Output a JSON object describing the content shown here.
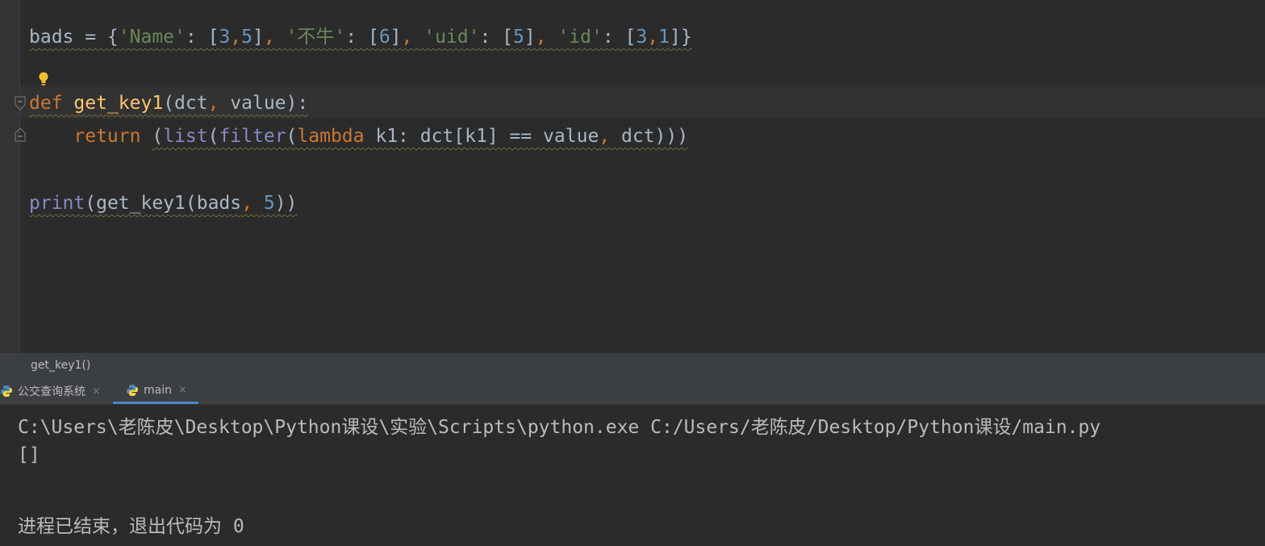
{
  "editor": {
    "line1": {
      "t1": "bads = {",
      "t2": "'Name'",
      "t3": ": [",
      "t4": "3",
      "t5": ",",
      "t6": "5",
      "t7": "]",
      "t8": ", ",
      "t9": "'不牛'",
      "t10": ": [",
      "t11": "6",
      "t12": "]",
      "t13": ", ",
      "t14": "'uid'",
      "t15": ": [",
      "t16": "5",
      "t17": "]",
      "t18": ", ",
      "t19": "'id'",
      "t20": ": [",
      "t21": "3",
      "t22": ",",
      "t23": "1",
      "t24": "]}"
    },
    "line3": {
      "kw": "def",
      "sp": " ",
      "fn": "get_key1",
      "p1": "(dct",
      "c": ", ",
      "p2": "value):"
    },
    "line4": {
      "indent": "    ",
      "kw": "return",
      "sp": " ",
      "open": "(",
      "list": "list",
      "o2": "(",
      "filter": "filter",
      "o3": "(",
      "lambda": "lambda",
      "body": " k1: dct[k1] == value",
      "c": ", ",
      "end": "dct)))"
    },
    "line6": {
      "print": "print",
      "a": "(get_key1(bads",
      "c": ", ",
      "n": "5",
      "e": "))"
    }
  },
  "breadcrumb": {
    "text": "get_key1()"
  },
  "run_tabs": [
    {
      "label": "公交查询系统",
      "close": "×"
    },
    {
      "label": "main",
      "close": "×"
    }
  ],
  "console": {
    "lines": [
      "C:\\Users\\老陈皮\\Desktop\\Python课设\\实验\\Scripts\\python.exe C:/Users/老陈皮/Desktop/Python课设/main.py",
      "[]",
      "",
      "进程已结束，退出代码为 0"
    ]
  },
  "colors": {
    "background": "#2b2b2b",
    "keyword": "#cc7832",
    "function": "#ffc66d",
    "string": "#6a8759",
    "number": "#6897bb",
    "builtin": "#8888c6",
    "text": "#a9b7c6"
  },
  "icons": [
    "intention-bulb-icon",
    "fold-marker-icon",
    "python-file-icon",
    "close-icon"
  ]
}
